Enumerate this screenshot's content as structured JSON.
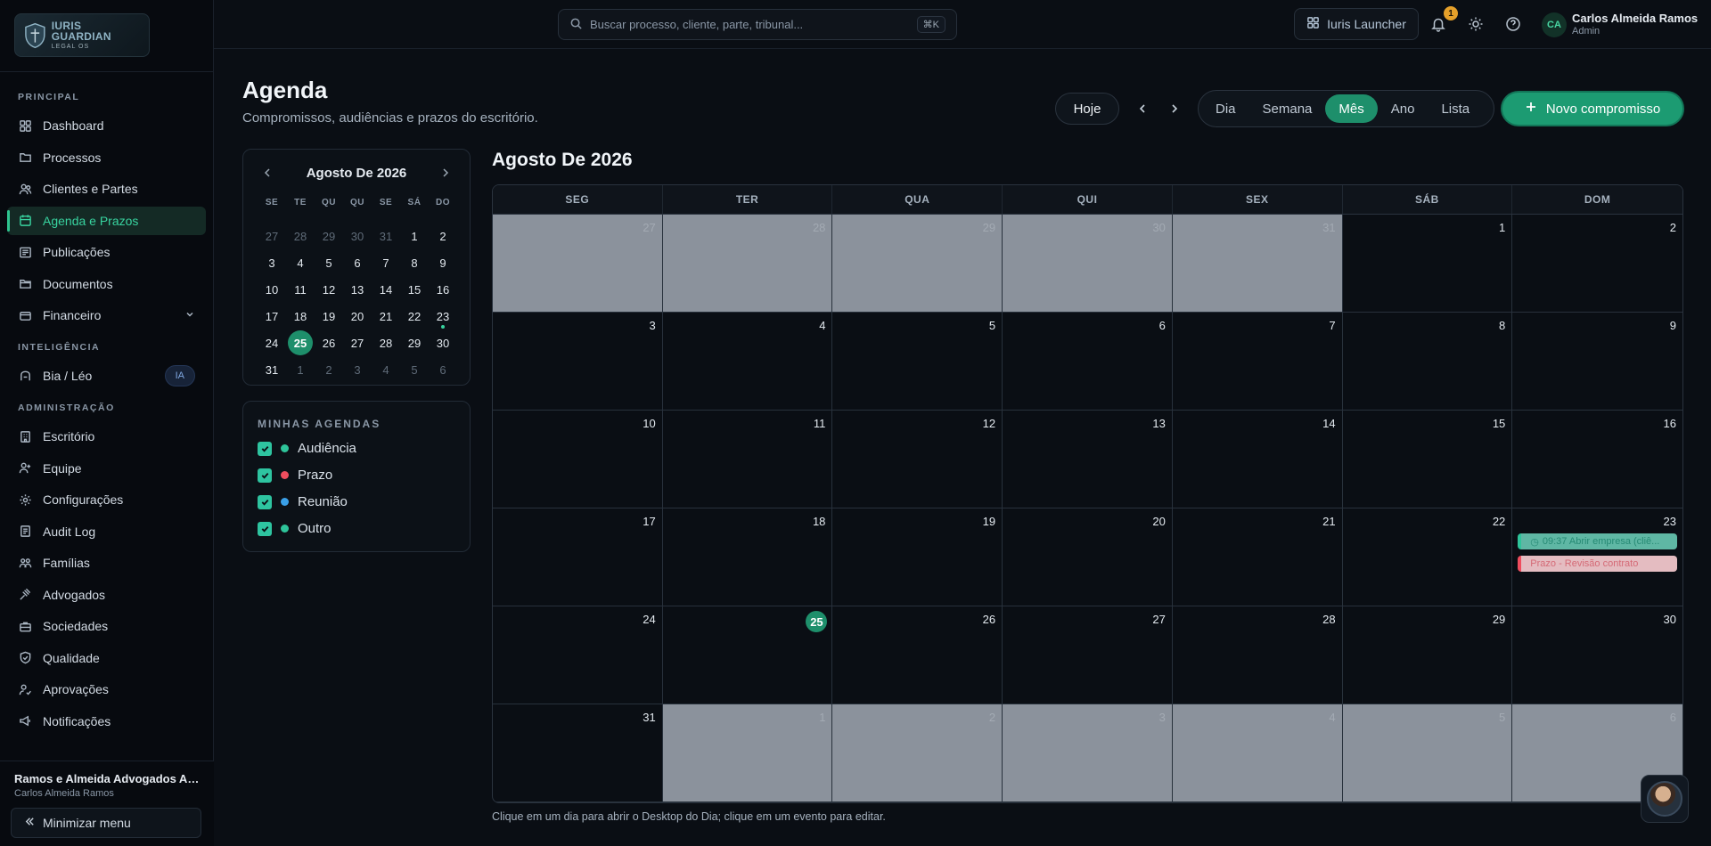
{
  "logo": {
    "line1": "IURIS GUARDIAN",
    "line2": "LEGAL OS"
  },
  "sidebar": {
    "section_principal": "PRINCIPAL",
    "section_ia": "INTELIGÊNCIA",
    "section_admin": "ADMINISTRAÇÃO",
    "principal": [
      {
        "label": "Dashboard",
        "icon": "grid-icon"
      },
      {
        "label": "Processos",
        "icon": "folder-icon"
      },
      {
        "label": "Clientes e Partes",
        "icon": "users-icon"
      },
      {
        "label": "Agenda e Prazos",
        "icon": "calendar-icon",
        "active": true
      },
      {
        "label": "Publicações",
        "icon": "newspaper-icon"
      },
      {
        "label": "Documentos",
        "icon": "folder-open-icon"
      },
      {
        "label": "Financeiro",
        "icon": "wallet-icon"
      }
    ],
    "ia": [
      {
        "label": "Bia / Léo",
        "icon": "sparkle-icon",
        "badge": "IA"
      }
    ],
    "admin": [
      {
        "label": "Escritório",
        "icon": "building-icon"
      },
      {
        "label": "Equipe",
        "icon": "team-icon"
      },
      {
        "label": "Configurações",
        "icon": "gear-icon"
      },
      {
        "label": "Audit Log",
        "icon": "log-icon"
      },
      {
        "label": "Famílias",
        "icon": "family-icon"
      },
      {
        "label": "Advogados",
        "icon": "gavel-icon"
      },
      {
        "label": "Sociedades",
        "icon": "briefcase-icon"
      },
      {
        "label": "Qualidade",
        "icon": "shield-icon"
      },
      {
        "label": "Aprovações",
        "icon": "check-users-icon"
      },
      {
        "label": "Notificações",
        "icon": "megaphone-icon"
      }
    ],
    "footer": {
      "firm": "Ramos e Almeida Advogados Associados",
      "user": "Carlos Almeida Ramos",
      "minimize": "Minimizar menu"
    }
  },
  "topbar": {
    "search_placeholder": "Buscar processo, cliente, parte, tribunal...",
    "shortcut": "⌘K",
    "launcher": "Iuris Launcher",
    "notification_count": "1",
    "avatar_initials": "CA",
    "user_name": "Carlos Almeida Ramos",
    "user_role": "Admin"
  },
  "page": {
    "title": "Agenda",
    "subtitle": "Compromissos, audiências e prazos do escritório.",
    "today": "Hoje",
    "views": [
      "Dia",
      "Semana",
      "Mês",
      "Ano",
      "Lista"
    ],
    "active_view": "Mês",
    "new_button": "Novo compromisso",
    "footnote": "Clique em um dia para abrir o Desktop do Dia; clique em um evento para editar."
  },
  "mini_calendar": {
    "month": "Agosto De 2026",
    "weekdays": [
      "SE",
      "TE",
      "QU",
      "QU",
      "SE",
      "SÁ",
      "DO"
    ],
    "days": [
      [
        "27",
        "28",
        "29",
        "30",
        "31",
        "1",
        "2"
      ],
      [
        "3",
        "4",
        "5",
        "6",
        "7",
        "8",
        "9"
      ],
      [
        "10",
        "11",
        "12",
        "13",
        "14",
        "15",
        "16"
      ],
      [
        "17",
        "18",
        "19",
        "20",
        "21",
        "22",
        "23"
      ],
      [
        "24",
        "25",
        "26",
        "27",
        "28",
        "29",
        "30"
      ],
      [
        "31",
        "1",
        "2",
        "3",
        "4",
        "5",
        "6"
      ]
    ]
  },
  "agendas": {
    "title": "MINHAS AGENDAS",
    "items": [
      {
        "label": "Audiência",
        "color": "#2ec49a"
      },
      {
        "label": "Prazo",
        "color": "#ef4d5e"
      },
      {
        "label": "Reunião",
        "color": "#3aa0e8"
      },
      {
        "label": "Outro",
        "color": "#2ec49a"
      }
    ]
  },
  "month_view": {
    "title": "Agosto De 2026",
    "weekdays": [
      "SEG",
      "TER",
      "QUA",
      "QUI",
      "SEX",
      "SÁB",
      "DOM"
    ],
    "weeks": [
      [
        "27",
        "28",
        "29",
        "30",
        "31",
        "1",
        "2"
      ],
      [
        "3",
        "4",
        "5",
        "6",
        "7",
        "8",
        "9"
      ],
      [
        "10",
        "11",
        "12",
        "13",
        "14",
        "15",
        "16"
      ],
      [
        "17",
        "18",
        "19",
        "20",
        "21",
        "22",
        "23"
      ],
      [
        "24",
        "25",
        "26",
        "27",
        "28",
        "29",
        "30"
      ],
      [
        "31",
        "1",
        "2",
        "3",
        "4",
        "5",
        "6"
      ]
    ],
    "events_day_23": [
      {
        "text": "09:37 Abrir empresa (cliê...",
        "type": "green"
      },
      {
        "text": "Prazo - Revisão contrato",
        "type": "red"
      }
    ]
  }
}
